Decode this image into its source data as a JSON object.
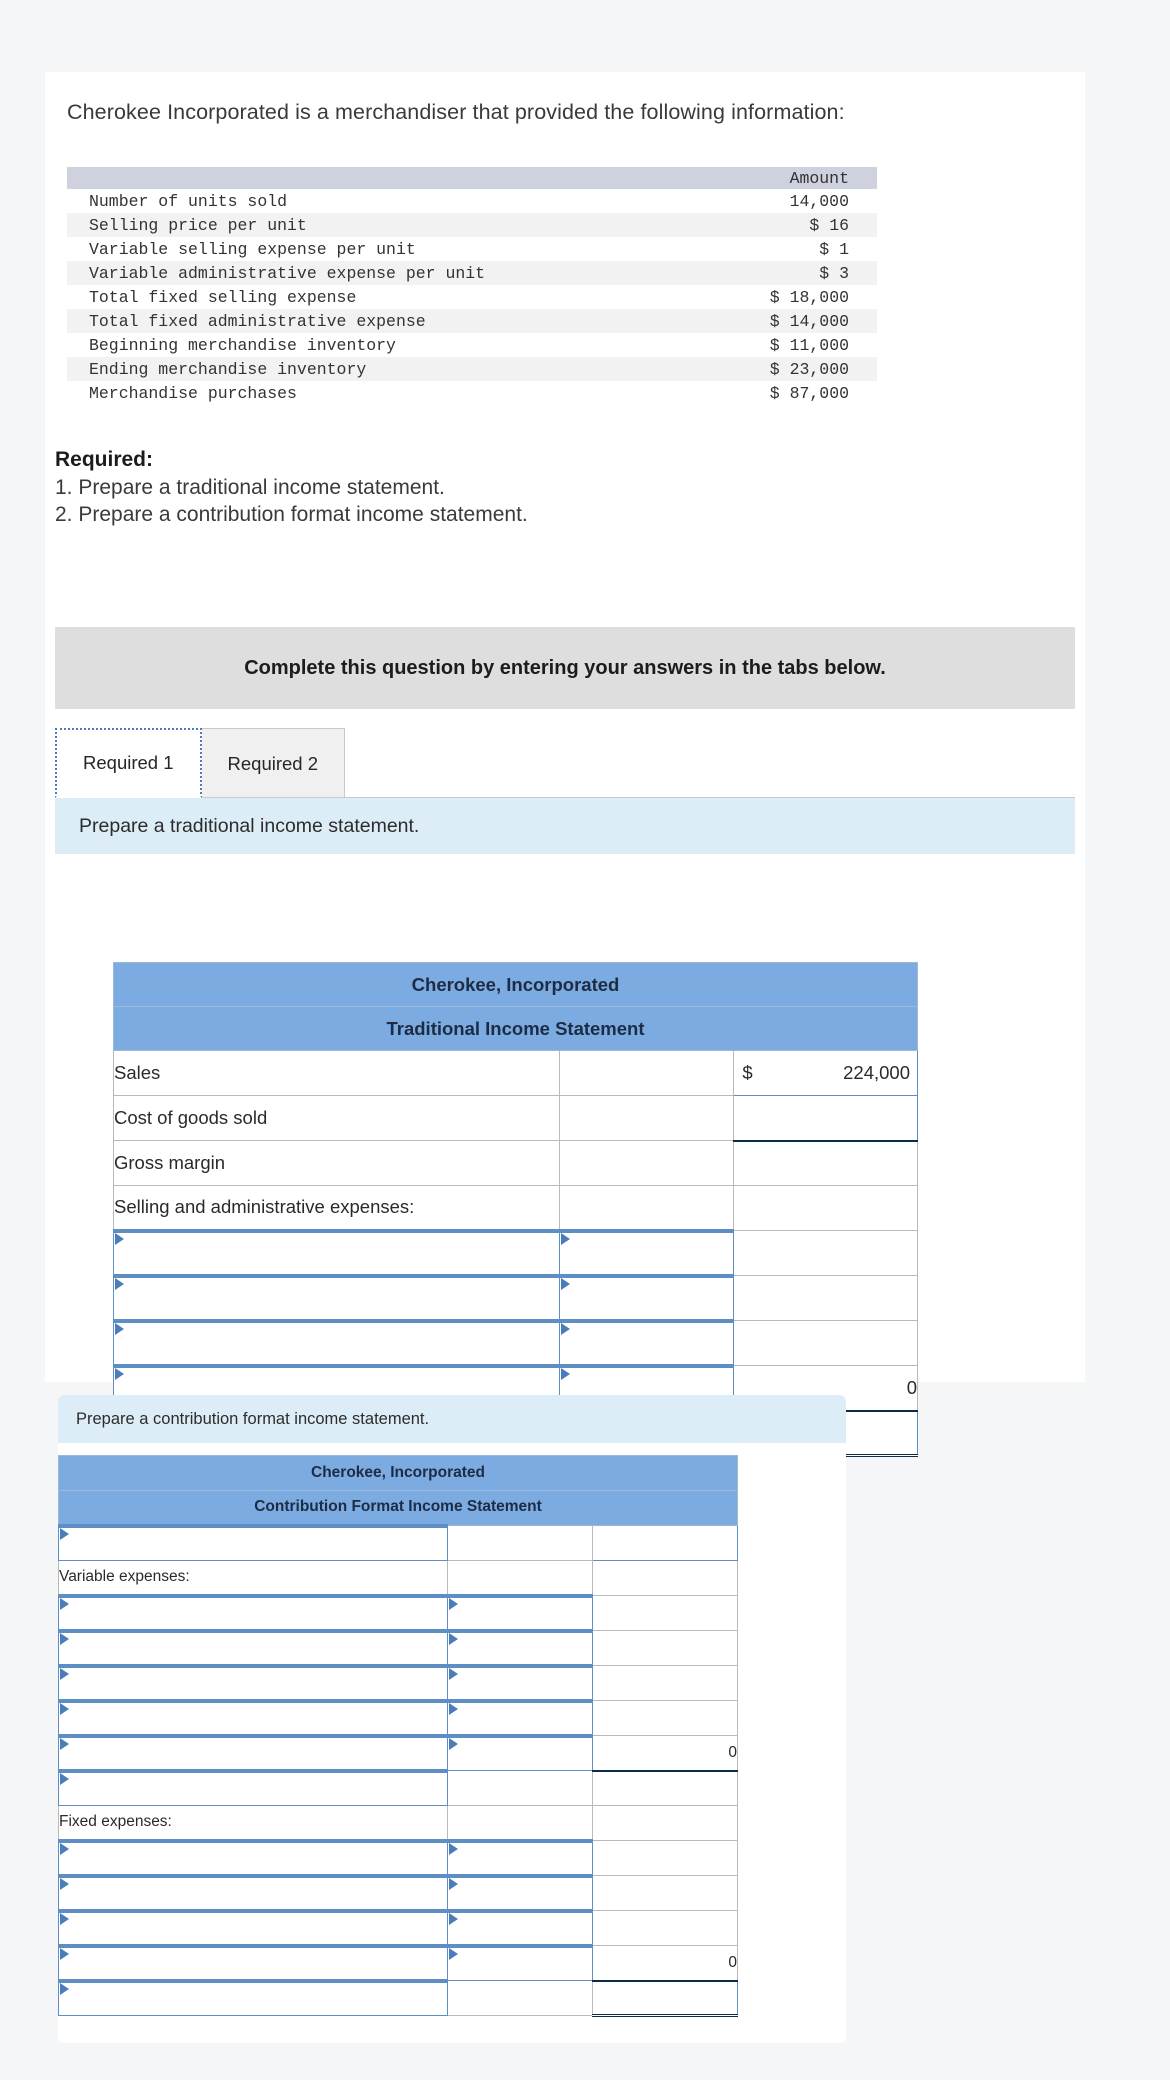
{
  "intro": {
    "text": "Cherokee Incorporated is a merchandiser that provided the following information:"
  },
  "data_table": {
    "header_label": "",
    "header_amount": "Amount",
    "rows": [
      {
        "label": "Number of units sold",
        "value": "14,000"
      },
      {
        "label": "Selling price per unit",
        "value": "$ 16"
      },
      {
        "label": "Variable selling expense per unit",
        "value": "$ 1"
      },
      {
        "label": "Variable administrative expense per unit",
        "value": "$ 3"
      },
      {
        "label": "Total fixed selling expense",
        "value": "$ 18,000"
      },
      {
        "label": "Total fixed administrative expense",
        "value": "$ 14,000"
      },
      {
        "label": "Beginning merchandise inventory",
        "value": "$ 11,000"
      },
      {
        "label": "Ending merchandise inventory",
        "value": "$ 23,000"
      },
      {
        "label": "Merchandise purchases",
        "value": "$ 87,000"
      }
    ]
  },
  "required": {
    "title": "Required:",
    "item1": "1. Prepare a traditional income statement.",
    "item2": "2. Prepare a contribution format income statement."
  },
  "banner": {
    "text": "Complete this question by entering your answers in the tabs below."
  },
  "tabs": {
    "items": [
      {
        "label": "Required 1",
        "active": true
      },
      {
        "label": "Required 2",
        "active": false
      }
    ]
  },
  "statement1": {
    "instruction": "Prepare a traditional income statement.",
    "company": "Cherokee, Incorporated",
    "subtitle": "Traditional Income Statement",
    "rows": [
      {
        "label": "Sales",
        "type": "static",
        "mid": "",
        "right": "224,000",
        "right_dollar": "$",
        "right_style": "num"
      },
      {
        "label": "Cost of goods sold",
        "type": "static",
        "mid": "",
        "right": "",
        "right_style": "num"
      },
      {
        "label": "Gross margin",
        "type": "static",
        "mid": "",
        "right": "",
        "right_style": "num-thick-top"
      },
      {
        "label": "Selling and administrative expenses:",
        "type": "static",
        "mid": "",
        "right": "",
        "right_style": "plain"
      },
      {
        "label": "",
        "type": "dropdown",
        "mid": "dropdown",
        "right": "",
        "right_style": "plain"
      },
      {
        "label": "",
        "type": "dropdown",
        "mid": "dropdown",
        "right": "",
        "right_style": "plain"
      },
      {
        "label": "",
        "type": "dropdown",
        "mid": "dropdown",
        "right": "",
        "right_style": "plain"
      },
      {
        "label": "",
        "type": "dropdown",
        "mid": "dropdown",
        "right": "0",
        "right_style": "plain"
      },
      {
        "label": "",
        "type": "dropdown",
        "mid": "",
        "right": "",
        "right_style": "final"
      }
    ]
  },
  "statement2": {
    "instruction": "Prepare a contribution format income statement.",
    "company": "Cherokee, Incorporated",
    "subtitle": "Contribution Format Income Statement",
    "rows": [
      {
        "label": "",
        "type": "dropdown",
        "mid": "",
        "right": "",
        "right_style": "num"
      },
      {
        "label": "Variable expenses:",
        "type": "static",
        "mid": "",
        "right": "",
        "right_style": "plain"
      },
      {
        "label": "",
        "type": "dropdown",
        "mid": "dropdown",
        "right": "",
        "right_style": "plain"
      },
      {
        "label": "",
        "type": "dropdown",
        "mid": "dropdown",
        "right": "",
        "right_style": "plain"
      },
      {
        "label": "",
        "type": "dropdown",
        "mid": "dropdown",
        "right": "",
        "right_style": "plain"
      },
      {
        "label": "",
        "type": "dropdown",
        "mid": "dropdown",
        "right": "",
        "right_style": "plain"
      },
      {
        "label": "",
        "type": "dropdown",
        "mid": "dropdown",
        "right": "0",
        "right_style": "plain"
      },
      {
        "label": "",
        "type": "dropdown",
        "mid": "",
        "right": "",
        "right_style": "num-thick-top"
      },
      {
        "label": "Fixed expenses:",
        "type": "static",
        "mid": "",
        "right": "",
        "right_style": "plain"
      },
      {
        "label": "",
        "type": "dropdown",
        "mid": "dropdown",
        "right": "",
        "right_style": "plain"
      },
      {
        "label": "",
        "type": "dropdown",
        "mid": "dropdown",
        "right": "",
        "right_style": "plain"
      },
      {
        "label": "",
        "type": "dropdown",
        "mid": "dropdown",
        "right": "",
        "right_style": "plain"
      },
      {
        "label": "",
        "type": "dropdown",
        "mid": "dropdown",
        "right": "0",
        "right_style": "plain"
      },
      {
        "label": "",
        "type": "dropdown",
        "mid": "",
        "right": "",
        "right_style": "final"
      }
    ]
  },
  "colors": {
    "header_blue": "#7cabe1",
    "instruction_blue": "#ddedf8",
    "banner_grey": "#dedede",
    "page_bg": "#f5f6f7",
    "input_border": "#5d8ec4"
  }
}
